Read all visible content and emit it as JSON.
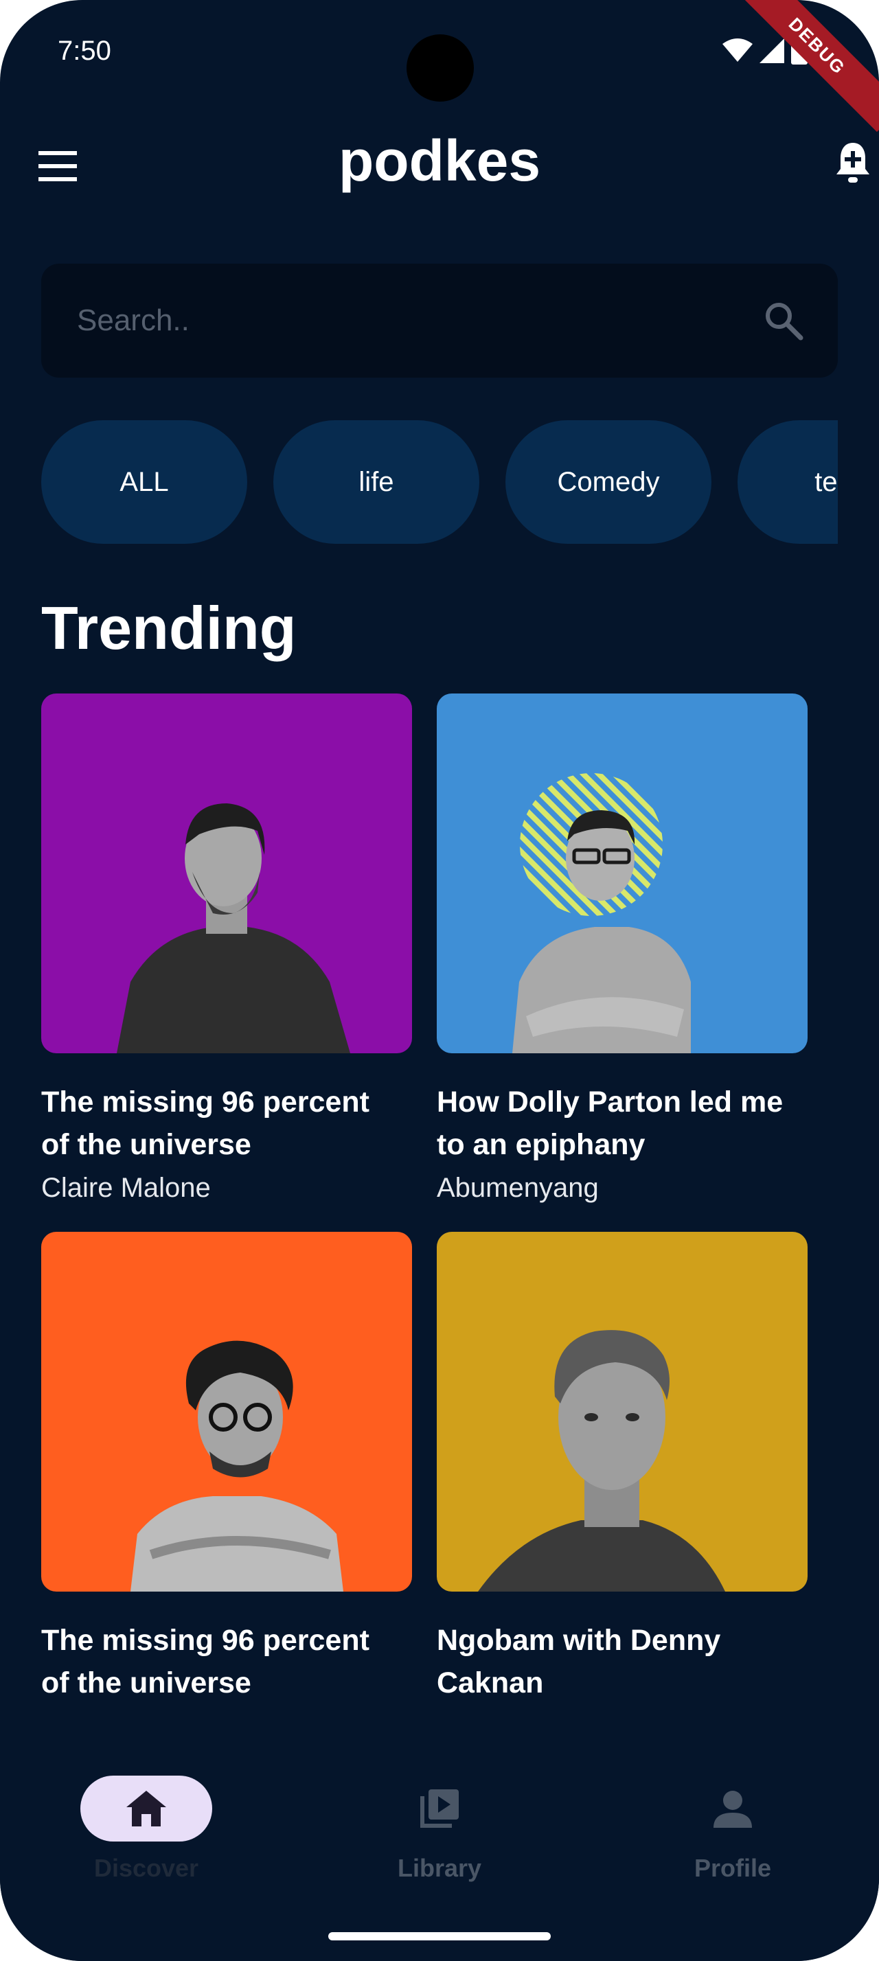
{
  "status_bar": {
    "time": "7:50",
    "debug_label": "DEBUG"
  },
  "app_bar": {
    "title": "podkes",
    "menu_icon": "menu-icon",
    "notification_icon": "notification-add-icon"
  },
  "search": {
    "placeholder": "Search..",
    "value": "",
    "icon": "search-icon"
  },
  "categories": [
    "ALL",
    "life",
    "Comedy",
    "tech"
  ],
  "trending": {
    "title": "Trending",
    "items": [
      {
        "title": "The missing 96 percent of the universe",
        "author": "Claire Malone",
        "color": "#8b0ea8"
      },
      {
        "title": "How Dolly Parton led me to an epiphany",
        "author": "Abumenyang",
        "color": "#3f8fd6"
      },
      {
        "title": "The missing 96 percent of the universe",
        "author": "",
        "color": "#ff5e1f"
      },
      {
        "title": "Ngobam with Denny Caknan",
        "author": "",
        "color": "#d0a01b"
      }
    ]
  },
  "bottom_nav": {
    "items": [
      {
        "label": "Discover",
        "icon": "home-icon",
        "active": true
      },
      {
        "label": "Library",
        "icon": "video-library-icon",
        "active": false
      },
      {
        "label": "Profile",
        "icon": "person-icon",
        "active": false
      }
    ]
  },
  "colors": {
    "background": "#05152b",
    "chip": "#072b4f",
    "search_bg": "#030d1c",
    "nav_active_pill": "#e8def8",
    "nav_inactive": "#4a5666"
  }
}
